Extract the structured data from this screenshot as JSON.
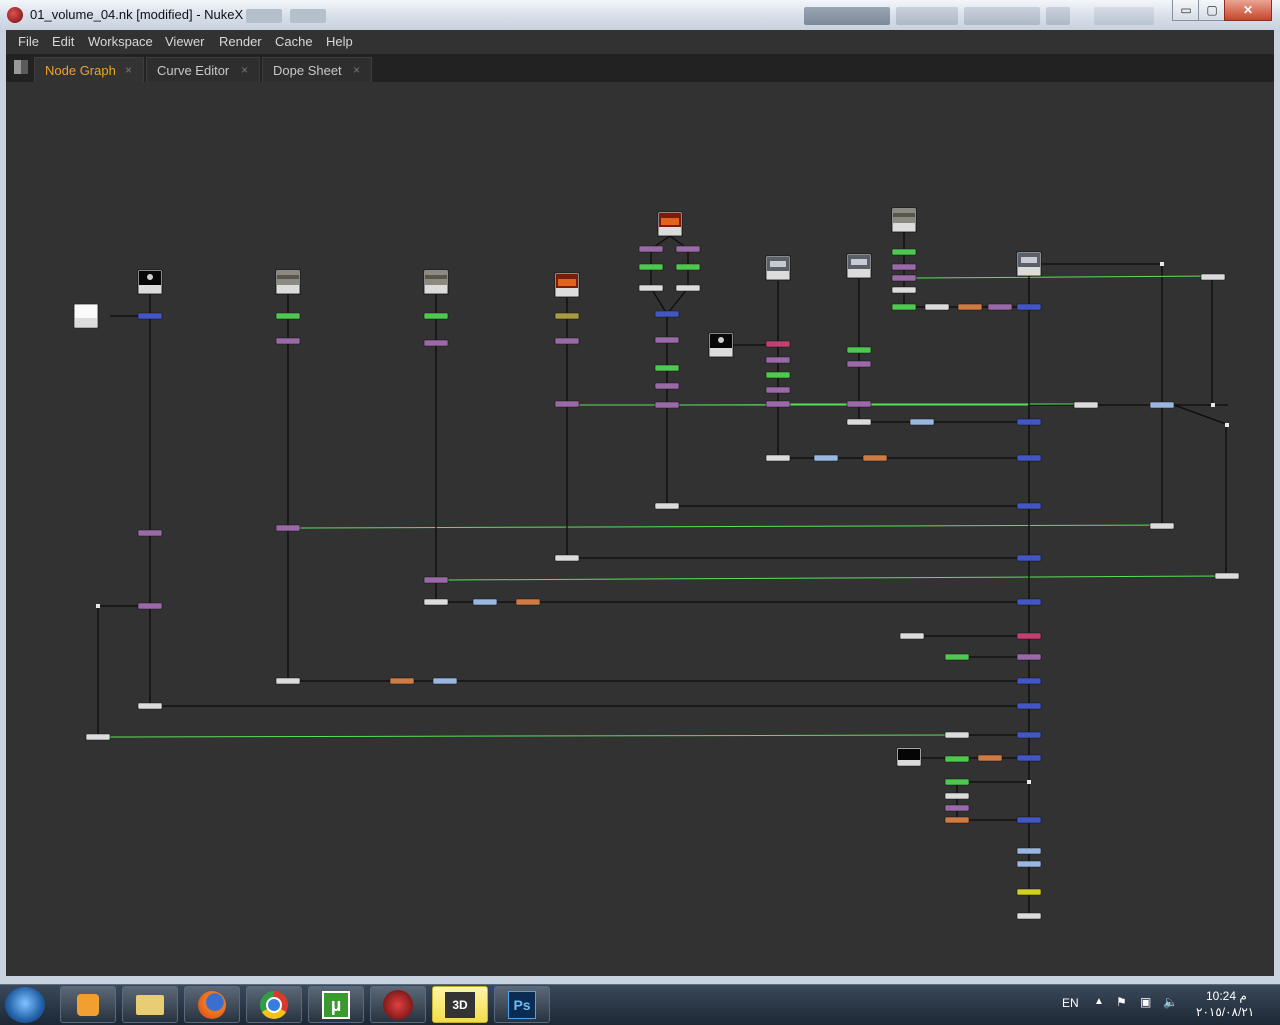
{
  "window": {
    "title": "01_volume_04.nk [modified] - NukeX",
    "controls": {
      "minimize": "▭",
      "maximize": "▢",
      "close": "✕"
    }
  },
  "menubar": [
    "File",
    "Edit",
    "Workspace",
    "Viewer",
    "Render",
    "Cache",
    "Help"
  ],
  "tabs": [
    {
      "label": "Node Graph",
      "active": true
    },
    {
      "label": "Curve Editor",
      "active": false
    },
    {
      "label": "Dope Sheet",
      "active": false
    }
  ],
  "tab_close_glyph": "×",
  "colors": {
    "graph_bg": "#323232",
    "edge": "#0c0c0c",
    "highlight_edge": "#58e058",
    "read": "#dcdcdc",
    "merge": "#4456c6",
    "grade": "#9a6aa8",
    "color_correct": "#4ec84e",
    "transform": "#9ab6e2",
    "blur": "#d07a44",
    "copy": "#c04070",
    "yellow": "#d0d020",
    "olive": "#a89a40"
  },
  "taskbar": {
    "apps": [
      "windows-media-player-icon",
      "explorer-icon",
      "firefox-icon",
      "chrome-icon",
      "utorrent-icon",
      "nuke-icon",
      "movie-maker-icon",
      "photoshop-icon"
    ],
    "utorrent_glyph": "µ",
    "photoshop_glyph": "Ps",
    "movie_glyph": "3D",
    "language": "EN",
    "time": "10:24 م",
    "date": "٢٠١٥/٠٨/٢١"
  }
}
